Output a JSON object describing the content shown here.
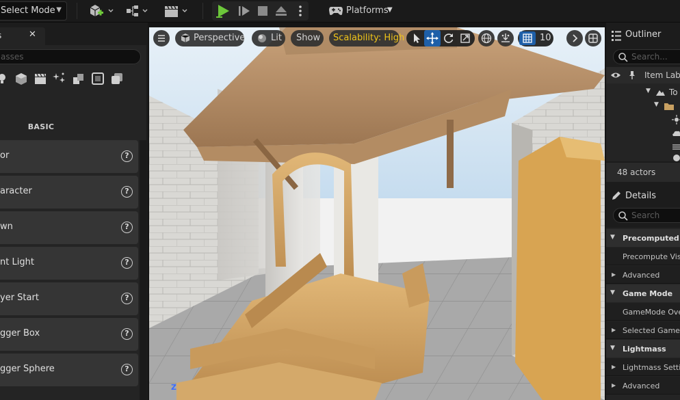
{
  "toolbar": {
    "mode_label": "Select Mode",
    "platforms_label": "Platforms"
  },
  "place_actors": {
    "tab_label": "s",
    "search_placeholder": "asses",
    "category_label": "BASIC",
    "items": [
      {
        "label": "or"
      },
      {
        "label": "aracter"
      },
      {
        "label": "wn"
      },
      {
        "label": "nt Light"
      },
      {
        "label": "yer Start"
      },
      {
        "label": "gger Box"
      },
      {
        "label": "gger Sphere"
      }
    ]
  },
  "viewport": {
    "perspective_label": "Perspective",
    "lit_label": "Lit",
    "show_label": "Show",
    "scalability_label": "Scalability: High",
    "grid_snap_value": "10",
    "axis_label": "Z",
    "colors": {
      "scalability_text": "#f0c419",
      "active_blue": "#1e5fa8"
    }
  },
  "outliner": {
    "title": "Outliner",
    "search_placeholder": "Search...",
    "column_label": "Item Labe",
    "tree_root_label": "To",
    "actor_count": "48 actors"
  },
  "details": {
    "title": "Details",
    "search_placeholder": "Search",
    "sections": [
      {
        "category": "Precomputed Visi",
        "props": [
          "Precompute Visib",
          "Advanced"
        ]
      },
      {
        "category": "Game Mode",
        "props": [
          "GameMode Over",
          "Selected GameM"
        ]
      },
      {
        "category": "Lightmass",
        "props": [
          "Lightmass Settin",
          "Advanced"
        ]
      }
    ]
  }
}
